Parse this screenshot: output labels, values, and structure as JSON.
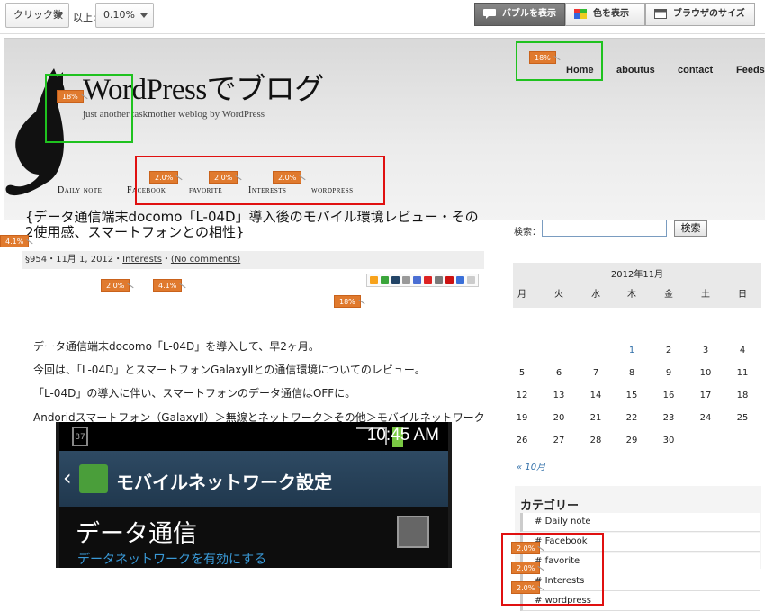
{
  "toolbar": {
    "metric_select": "クリック数",
    "threshold_label": "以上:",
    "threshold_select": "0.10%",
    "buttons": [
      {
        "label": "バブルを表示",
        "active": true
      },
      {
        "label": "色を表示",
        "active": false
      },
      {
        "label": "ブラウザのサイズ",
        "active": false
      }
    ]
  },
  "site": {
    "top_nav": [
      "Home",
      "aboutus",
      "contact",
      "Feeds"
    ],
    "title": "WordPressでブログ",
    "tagline": "just another taskmother weblog by WordPress",
    "category_nav": [
      "Daily note",
      "Facebook",
      "favorite",
      "Interests",
      "wordpress"
    ]
  },
  "post": {
    "title": "{データ通信端末docomo「L-04D」導入後のモバイル環境レビュー・その2使用感、スマートフォンとの相性}",
    "meta_prefix": "§954・11月 1, 2012・",
    "meta_category": "Interests",
    "meta_sep": "・",
    "meta_comments": "(No comments)",
    "paragraphs": [
      "データ通信端末docomo「L-04D」を導入して、早2ヶ月。",
      "今回は、「L-04D」とスマートフォンGalaxyⅡとの通信環境についてのレビュー。",
      "「L-04D」の導入に伴い、スマートフォンのデータ通信はOFFに。",
      "Andoridスマートフォン（GalaxyⅡ）＞無線とネットワーク＞その他＞モバイルネットワーク"
    ],
    "phone": {
      "time": "10:45 AM",
      "battery": "87",
      "bar_title": "モバイルネットワーク設定",
      "item_title": "データ通信",
      "item_sub": "データネットワークを有効にする"
    }
  },
  "sidebar": {
    "search_label": "検索：",
    "search_value": "",
    "search_button": "検索",
    "calendar": {
      "caption": "2012年11月",
      "weekdays": [
        "月",
        "火",
        "水",
        "木",
        "金",
        "土",
        "日"
      ],
      "rows": [
        [
          "",
          "",
          "",
          "1",
          "2",
          "3",
          "4"
        ],
        [
          "5",
          "6",
          "7",
          "8",
          "9",
          "10",
          "11"
        ],
        [
          "12",
          "13",
          "14",
          "15",
          "16",
          "17",
          "18"
        ],
        [
          "19",
          "20",
          "21",
          "22",
          "23",
          "24",
          "25"
        ],
        [
          "26",
          "27",
          "28",
          "29",
          "30",
          "",
          ""
        ]
      ],
      "prev_link": "« 10月"
    },
    "categories_title": "カテゴリー",
    "categories": [
      "Daily note",
      "Facebook",
      "favorite",
      "Interests",
      "wordpress"
    ]
  },
  "bubbles": {
    "cat_logo": "18%",
    "home": "18%",
    "nav_facebook": "2.0%",
    "nav_favorite": "2.0%",
    "nav_interests": "2.0%",
    "post_title": "4.1%",
    "meta_date": "2.0%",
    "meta_category": "4.1%",
    "share": "18%",
    "side_facebook": "2.0%",
    "side_favorite": "2.0%",
    "side_interests": "2.0%"
  },
  "colors": {
    "bubble": "#e07a2e",
    "highlight_green": "#1fc21f",
    "highlight_red": "#e01010",
    "link": "#2f6ea8"
  }
}
